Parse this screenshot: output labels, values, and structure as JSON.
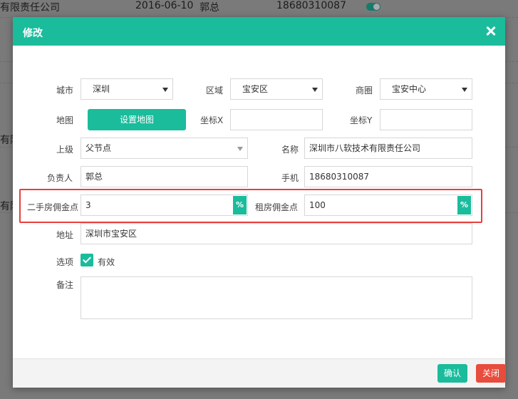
{
  "background": {
    "row1": {
      "company": "有限责任公司",
      "date": "2016-06-10",
      "person": "郭总",
      "phone": "18680310087"
    },
    "partial_texts": [
      "有限",
      "有限"
    ]
  },
  "modal": {
    "title": "修改",
    "fields": {
      "city": {
        "label": "城市",
        "value": "深圳"
      },
      "district": {
        "label": "区域",
        "value": "宝安区"
      },
      "business_area": {
        "label": "商圈",
        "value": "宝安中心"
      },
      "map": {
        "label": "地图",
        "button": "设置地图"
      },
      "coord_x": {
        "label": "坐标X",
        "value": ""
      },
      "coord_y": {
        "label": "坐标Y",
        "value": ""
      },
      "parent": {
        "label": "上级",
        "value": "父节点"
      },
      "name": {
        "label": "名称",
        "value": "深圳市八软技术有限责任公司"
      },
      "manager": {
        "label": "负责人",
        "value": "郭总"
      },
      "phone": {
        "label": "手机",
        "value": "18680310087"
      },
      "secondhand_commission": {
        "label": "二手房佣金点",
        "value": "3",
        "unit": "%"
      },
      "rental_commission": {
        "label": "租房佣金点",
        "value": "100",
        "unit": "%"
      },
      "address": {
        "label": "地址",
        "value": "深圳市宝安区"
      },
      "options": {
        "label": "选项",
        "checkbox_label": "有效",
        "checked": true
      },
      "remark": {
        "label": "备注",
        "value": ""
      }
    },
    "footer": {
      "confirm": "确认",
      "close": "关闭"
    }
  },
  "colors": {
    "accent": "#1abc9c",
    "danger": "#e74c3c",
    "highlight_border": "#e8403c"
  }
}
